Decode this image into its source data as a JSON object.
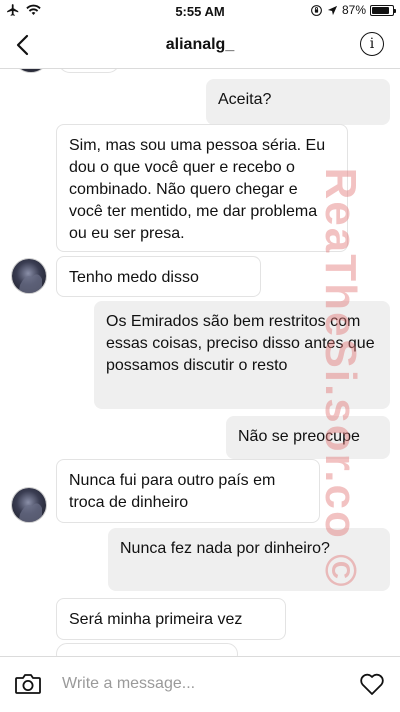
{
  "status_bar": {
    "time": "5:55 AM",
    "battery_percent": "87%",
    "battery_level": 0.87,
    "icons": [
      "airplane-mode-icon",
      "wifi-icon",
      "location-icon",
      "battery-icon"
    ]
  },
  "header": {
    "username": "alianalg_",
    "back_icon": "chevron-left-icon",
    "info_label": "i"
  },
  "messages": [
    {
      "from": "me",
      "text": "Aceita?"
    },
    {
      "from": "them",
      "text": "Sim, mas sou uma pessoa séria. Eu dou o que você quer e recebo o combinado. Não quero chegar e você ter mentido, me dar problema ou eu ser presa."
    },
    {
      "from": "them",
      "text": "Tenho medo disso"
    },
    {
      "from": "me",
      "text": "Os Emirados são bem restritos com essas coisas, preciso disso antes que possamos discutir o resto"
    },
    {
      "from": "me",
      "text": "Não se preocupe"
    },
    {
      "from": "them",
      "text": "Nunca fui para outro país em troca de dinheiro"
    },
    {
      "from": "me",
      "text": "Nunca fez nada por dinheiro?"
    },
    {
      "from": "them",
      "text": "Será minha primeira vez"
    }
  ],
  "watermark": {
    "text": "ReaTheSi.sor.co ©"
  },
  "composer": {
    "placeholder": "Write a message...",
    "camera_icon": "camera-icon",
    "like_icon": "heart-icon"
  },
  "colors": {
    "sent_bubble": "#efefef",
    "received_border": "#e3e3e3",
    "divider": "#dbdbdb",
    "watermark": "#e27878"
  }
}
